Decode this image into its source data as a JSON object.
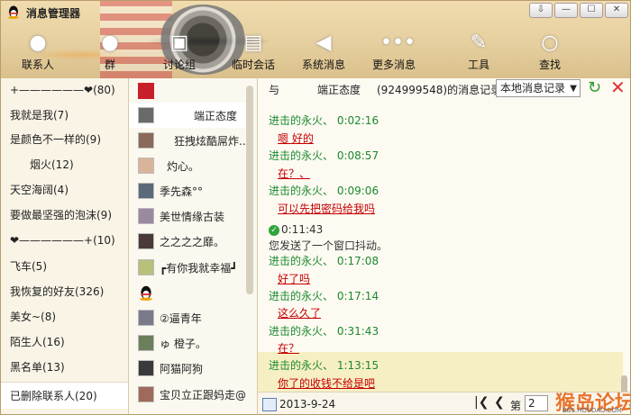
{
  "app": {
    "title": "消息管理器",
    "window_buttons": [
      "⇩",
      "—",
      "☐",
      "✕"
    ]
  },
  "toolbar": [
    {
      "label": "联系人",
      "icon": "user-icon"
    },
    {
      "label": "群",
      "icon": "group-icon"
    },
    {
      "label": "讨论组",
      "icon": "discussion-icon"
    },
    {
      "label": "临时会话",
      "icon": "temp-chat-icon"
    },
    {
      "label": "系统消息",
      "icon": "speaker-icon"
    },
    {
      "label": "更多消息",
      "icon": "more-icon"
    },
    {
      "label": "工具",
      "icon": "wrench-icon"
    },
    {
      "label": "查找",
      "icon": "search-icon"
    }
  ],
  "groups": [
    "+——————❤(80)",
    "我就是我(7)",
    "是颜色不一样的(9)",
    "烟火(12)",
    "天空海阔(4)",
    "要做最坚强的泡沫(9)",
    "❤——————+(10)",
    "飞车(5)",
    "我恢复的好友(326)",
    "美女~(8)",
    "陌生人(16)",
    "黑名单(13)",
    "已删除联系人(20)"
  ],
  "contacts": [
    "",
    "端正态度",
    "狂拽炫酷屌炸...",
    "灼心。",
    "季先森°°",
    "美世情缘古装",
    "之之之之靡。",
    "┏有你我就幸福┛",
    "",
    "②逼青年",
    "ゅ 橙子。",
    "阿猫阿狗",
    "宝贝立正跟妈走@"
  ],
  "record_header": {
    "with": "与",
    "name": "端正态度",
    "qq": "(924999548)的消息记录",
    "source": "本地消息记录"
  },
  "messages": [
    {
      "meta": "进击的永火、 0:02:16",
      "text": "嗯 好的"
    },
    {
      "meta": "进击的永火、 0:08:57",
      "text": "在？、"
    },
    {
      "meta": "进击的永火、 0:09:06",
      "text": "可以先把密码给我吗"
    },
    {
      "meta": "0:11:43",
      "text": "您发送了一个窗口抖动。"
    },
    {
      "meta": "进击的永火、 0:17:08",
      "text": "好了吗"
    },
    {
      "meta": "进击的永火、 0:17:14",
      "text": "这么久了"
    },
    {
      "meta": "进击的永火、 0:31:43",
      "text": "在？"
    },
    {
      "meta": "进击的永火、 1:13:15",
      "text": "你了的收钱不给是吧"
    }
  ],
  "footer": {
    "date": "2013-9-24",
    "first": "|❮",
    "prev": "❮",
    "page_label": "第",
    "page": "2",
    "watermark": "猴岛论坛",
    "watermark_url": "BBS.HOUDAO.COM"
  }
}
